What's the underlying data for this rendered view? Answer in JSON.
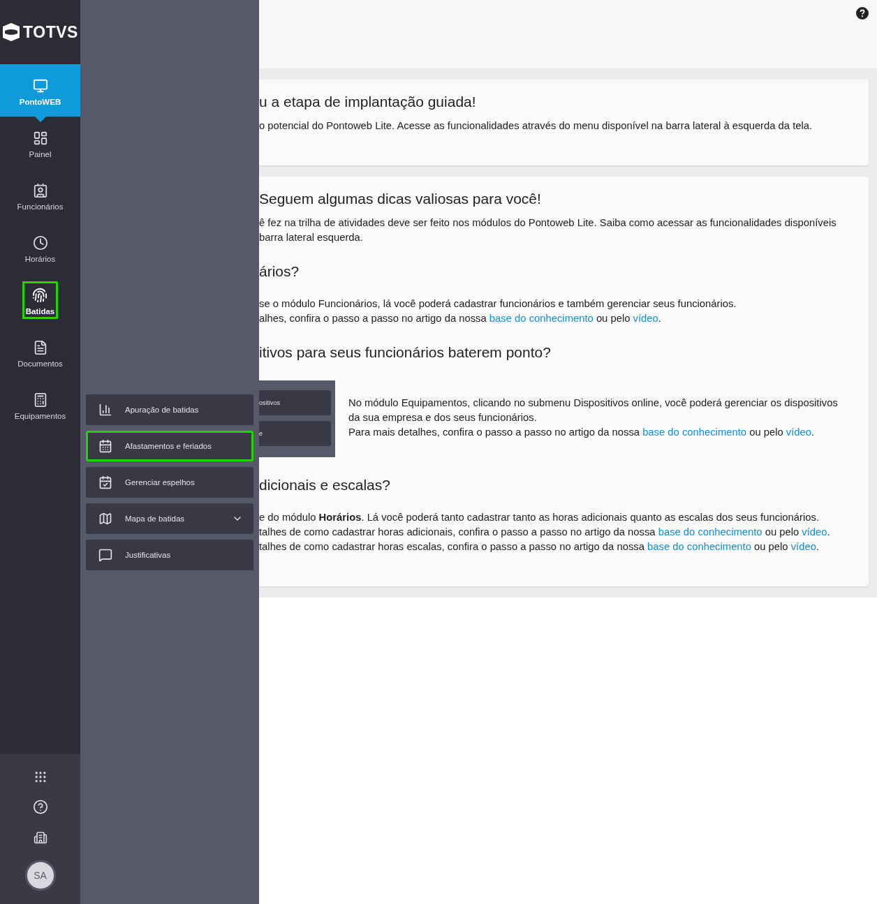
{
  "logo": {
    "text": "TOTVS"
  },
  "rail": {
    "items": [
      {
        "label": "PontoWEB",
        "selected": true,
        "highlighted": false
      },
      {
        "label": "Painel",
        "selected": false,
        "highlighted": false
      },
      {
        "label": "Funcionários",
        "selected": false,
        "highlighted": false
      },
      {
        "label": "Horários",
        "selected": false,
        "highlighted": false
      },
      {
        "label": "Batidas",
        "selected": false,
        "highlighted": true
      },
      {
        "label": "Documentos",
        "selected": false,
        "highlighted": false
      },
      {
        "label": "Equipamentos",
        "selected": false,
        "highlighted": false
      }
    ],
    "footer": {
      "avatar": "SA"
    }
  },
  "submenu": {
    "items": [
      {
        "label": "Apuração de batidas",
        "highlighted": false,
        "expandable": false
      },
      {
        "label": "Afastamentos e feriados",
        "highlighted": true,
        "expandable": false
      },
      {
        "label": "Gerenciar espelhos",
        "highlighted": false,
        "expandable": false
      },
      {
        "label": "Mapa de batidas",
        "highlighted": false,
        "expandable": true
      },
      {
        "label": "Justificativas",
        "highlighted": false,
        "expandable": false
      }
    ]
  },
  "cards": [
    {
      "blocks": [
        {
          "kind": "title",
          "text": "u a etapa de implantação guiada!"
        },
        {
          "kind": "lines",
          "lines": [
            [
              {
                "kind": "text",
                "text": "o potencial do Pontoweb Lite. Acesse as funcionalidades através do menu disponível na barra lateral à esquerda da tela."
              }
            ]
          ]
        }
      ]
    },
    {
      "blocks": [
        {
          "kind": "title",
          "text": "Seguem algumas dicas valiosas para você!"
        },
        {
          "kind": "lines",
          "lines": [
            [
              {
                "kind": "text",
                "text": "ê fez na trilha de atividades deve ser feito nos módulos do Pontoweb Lite. Saiba como acessar as funcionalidades disponíveis"
              }
            ],
            [
              {
                "kind": "text",
                "text": "barra lateral esquerda."
              }
            ]
          ]
        },
        {
          "kind": "heading",
          "text": "ários?"
        },
        {
          "kind": "lines",
          "lines": [
            [
              {
                "kind": "text",
                "text": "se o módulo Funcionários, lá você poderá cadastrar funcionários e também gerenciar seus funcionários."
              }
            ],
            [
              {
                "kind": "text",
                "text": "alhes, confira o passo a passo no artigo da nossa "
              },
              {
                "kind": "link",
                "text": "base do conhecimento"
              },
              {
                "kind": "text",
                "text": " ou pelo "
              },
              {
                "kind": "link",
                "text": "vídeo"
              },
              {
                "kind": "text",
                "text": "."
              }
            ]
          ]
        },
        {
          "kind": "heading",
          "text": "itivos para seus funcionários baterem ponto?"
        },
        {
          "kind": "figure",
          "menu": [
            "ositivos",
            "e"
          ],
          "lines": [
            [
              {
                "kind": "text",
                "text": "No módulo Equipamentos, clicando no submenu Dispositivos online, você poderá gerenciar os dispositivos"
              }
            ],
            [
              {
                "kind": "text",
                "text": "da sua empresa e dos seus funcionários."
              }
            ],
            [
              {
                "kind": "text",
                "text": "Para mais detalhes, confira o passo a passo no artigo da nossa "
              },
              {
                "kind": "link",
                "text": "base do conhecimento"
              },
              {
                "kind": "text",
                "text": " ou pelo "
              },
              {
                "kind": "link",
                "text": "vídeo"
              },
              {
                "kind": "text",
                "text": "."
              }
            ]
          ]
        },
        {
          "kind": "heading",
          "text": "dicionais e escalas?"
        },
        {
          "kind": "lines",
          "lines": [
            [
              {
                "kind": "text",
                "text": "e do módulo **Horários**. Lá você poderá tanto cadastrar tanto as horas adicionais quanto as escalas dos seus funcionários."
              }
            ],
            [
              {
                "kind": "text",
                "text": "talhes de como cadastrar horas adicionais, confira o passo a passo no artigo da nossa "
              },
              {
                "kind": "link",
                "text": "base do conhecimento"
              },
              {
                "kind": "text",
                "text": " ou pelo "
              },
              {
                "kind": "link",
                "text": "vídeo"
              },
              {
                "kind": "text",
                "text": "."
              }
            ],
            [
              {
                "kind": "text",
                "text": "talhes de como cadastrar horas escalas, confira o passo a passo no artigo da nossa "
              },
              {
                "kind": "link",
                "text": "base do conhecimento"
              },
              {
                "kind": "text",
                "text": " ou pelo "
              },
              {
                "kind": "link",
                "text": "vídeo"
              },
              {
                "kind": "text",
                "text": "."
              }
            ]
          ]
        }
      ]
    }
  ]
}
